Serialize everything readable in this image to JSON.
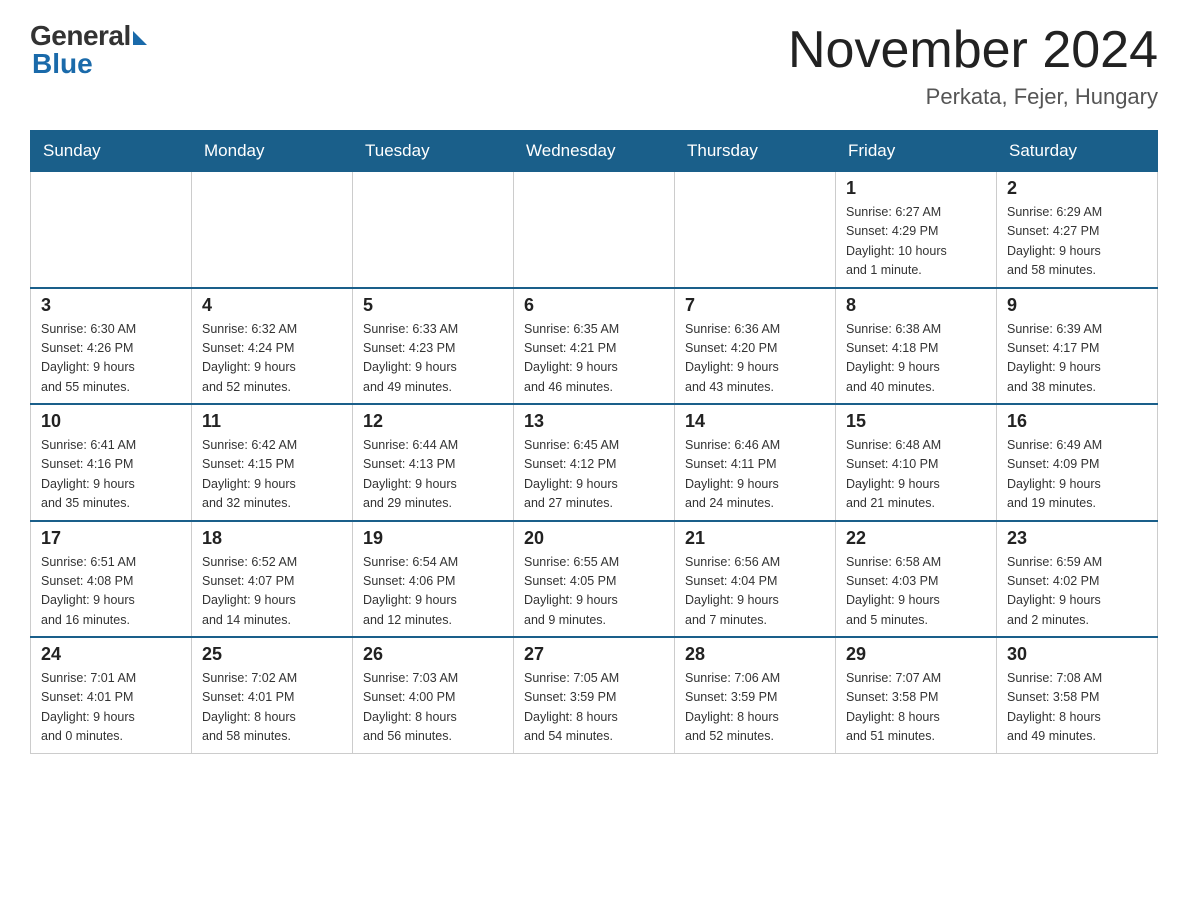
{
  "logo": {
    "general": "General",
    "blue": "Blue"
  },
  "title": "November 2024",
  "subtitle": "Perkata, Fejer, Hungary",
  "headers": [
    "Sunday",
    "Monday",
    "Tuesday",
    "Wednesday",
    "Thursday",
    "Friday",
    "Saturday"
  ],
  "weeks": [
    [
      {
        "day": "",
        "info": ""
      },
      {
        "day": "",
        "info": ""
      },
      {
        "day": "",
        "info": ""
      },
      {
        "day": "",
        "info": ""
      },
      {
        "day": "",
        "info": ""
      },
      {
        "day": "1",
        "info": "Sunrise: 6:27 AM\nSunset: 4:29 PM\nDaylight: 10 hours\nand 1 minute."
      },
      {
        "day": "2",
        "info": "Sunrise: 6:29 AM\nSunset: 4:27 PM\nDaylight: 9 hours\nand 58 minutes."
      }
    ],
    [
      {
        "day": "3",
        "info": "Sunrise: 6:30 AM\nSunset: 4:26 PM\nDaylight: 9 hours\nand 55 minutes."
      },
      {
        "day": "4",
        "info": "Sunrise: 6:32 AM\nSunset: 4:24 PM\nDaylight: 9 hours\nand 52 minutes."
      },
      {
        "day": "5",
        "info": "Sunrise: 6:33 AM\nSunset: 4:23 PM\nDaylight: 9 hours\nand 49 minutes."
      },
      {
        "day": "6",
        "info": "Sunrise: 6:35 AM\nSunset: 4:21 PM\nDaylight: 9 hours\nand 46 minutes."
      },
      {
        "day": "7",
        "info": "Sunrise: 6:36 AM\nSunset: 4:20 PM\nDaylight: 9 hours\nand 43 minutes."
      },
      {
        "day": "8",
        "info": "Sunrise: 6:38 AM\nSunset: 4:18 PM\nDaylight: 9 hours\nand 40 minutes."
      },
      {
        "day": "9",
        "info": "Sunrise: 6:39 AM\nSunset: 4:17 PM\nDaylight: 9 hours\nand 38 minutes."
      }
    ],
    [
      {
        "day": "10",
        "info": "Sunrise: 6:41 AM\nSunset: 4:16 PM\nDaylight: 9 hours\nand 35 minutes."
      },
      {
        "day": "11",
        "info": "Sunrise: 6:42 AM\nSunset: 4:15 PM\nDaylight: 9 hours\nand 32 minutes."
      },
      {
        "day": "12",
        "info": "Sunrise: 6:44 AM\nSunset: 4:13 PM\nDaylight: 9 hours\nand 29 minutes."
      },
      {
        "day": "13",
        "info": "Sunrise: 6:45 AM\nSunset: 4:12 PM\nDaylight: 9 hours\nand 27 minutes."
      },
      {
        "day": "14",
        "info": "Sunrise: 6:46 AM\nSunset: 4:11 PM\nDaylight: 9 hours\nand 24 minutes."
      },
      {
        "day": "15",
        "info": "Sunrise: 6:48 AM\nSunset: 4:10 PM\nDaylight: 9 hours\nand 21 minutes."
      },
      {
        "day": "16",
        "info": "Sunrise: 6:49 AM\nSunset: 4:09 PM\nDaylight: 9 hours\nand 19 minutes."
      }
    ],
    [
      {
        "day": "17",
        "info": "Sunrise: 6:51 AM\nSunset: 4:08 PM\nDaylight: 9 hours\nand 16 minutes."
      },
      {
        "day": "18",
        "info": "Sunrise: 6:52 AM\nSunset: 4:07 PM\nDaylight: 9 hours\nand 14 minutes."
      },
      {
        "day": "19",
        "info": "Sunrise: 6:54 AM\nSunset: 4:06 PM\nDaylight: 9 hours\nand 12 minutes."
      },
      {
        "day": "20",
        "info": "Sunrise: 6:55 AM\nSunset: 4:05 PM\nDaylight: 9 hours\nand 9 minutes."
      },
      {
        "day": "21",
        "info": "Sunrise: 6:56 AM\nSunset: 4:04 PM\nDaylight: 9 hours\nand 7 minutes."
      },
      {
        "day": "22",
        "info": "Sunrise: 6:58 AM\nSunset: 4:03 PM\nDaylight: 9 hours\nand 5 minutes."
      },
      {
        "day": "23",
        "info": "Sunrise: 6:59 AM\nSunset: 4:02 PM\nDaylight: 9 hours\nand 2 minutes."
      }
    ],
    [
      {
        "day": "24",
        "info": "Sunrise: 7:01 AM\nSunset: 4:01 PM\nDaylight: 9 hours\nand 0 minutes."
      },
      {
        "day": "25",
        "info": "Sunrise: 7:02 AM\nSunset: 4:01 PM\nDaylight: 8 hours\nand 58 minutes."
      },
      {
        "day": "26",
        "info": "Sunrise: 7:03 AM\nSunset: 4:00 PM\nDaylight: 8 hours\nand 56 minutes."
      },
      {
        "day": "27",
        "info": "Sunrise: 7:05 AM\nSunset: 3:59 PM\nDaylight: 8 hours\nand 54 minutes."
      },
      {
        "day": "28",
        "info": "Sunrise: 7:06 AM\nSunset: 3:59 PM\nDaylight: 8 hours\nand 52 minutes."
      },
      {
        "day": "29",
        "info": "Sunrise: 7:07 AM\nSunset: 3:58 PM\nDaylight: 8 hours\nand 51 minutes."
      },
      {
        "day": "30",
        "info": "Sunrise: 7:08 AM\nSunset: 3:58 PM\nDaylight: 8 hours\nand 49 minutes."
      }
    ]
  ]
}
